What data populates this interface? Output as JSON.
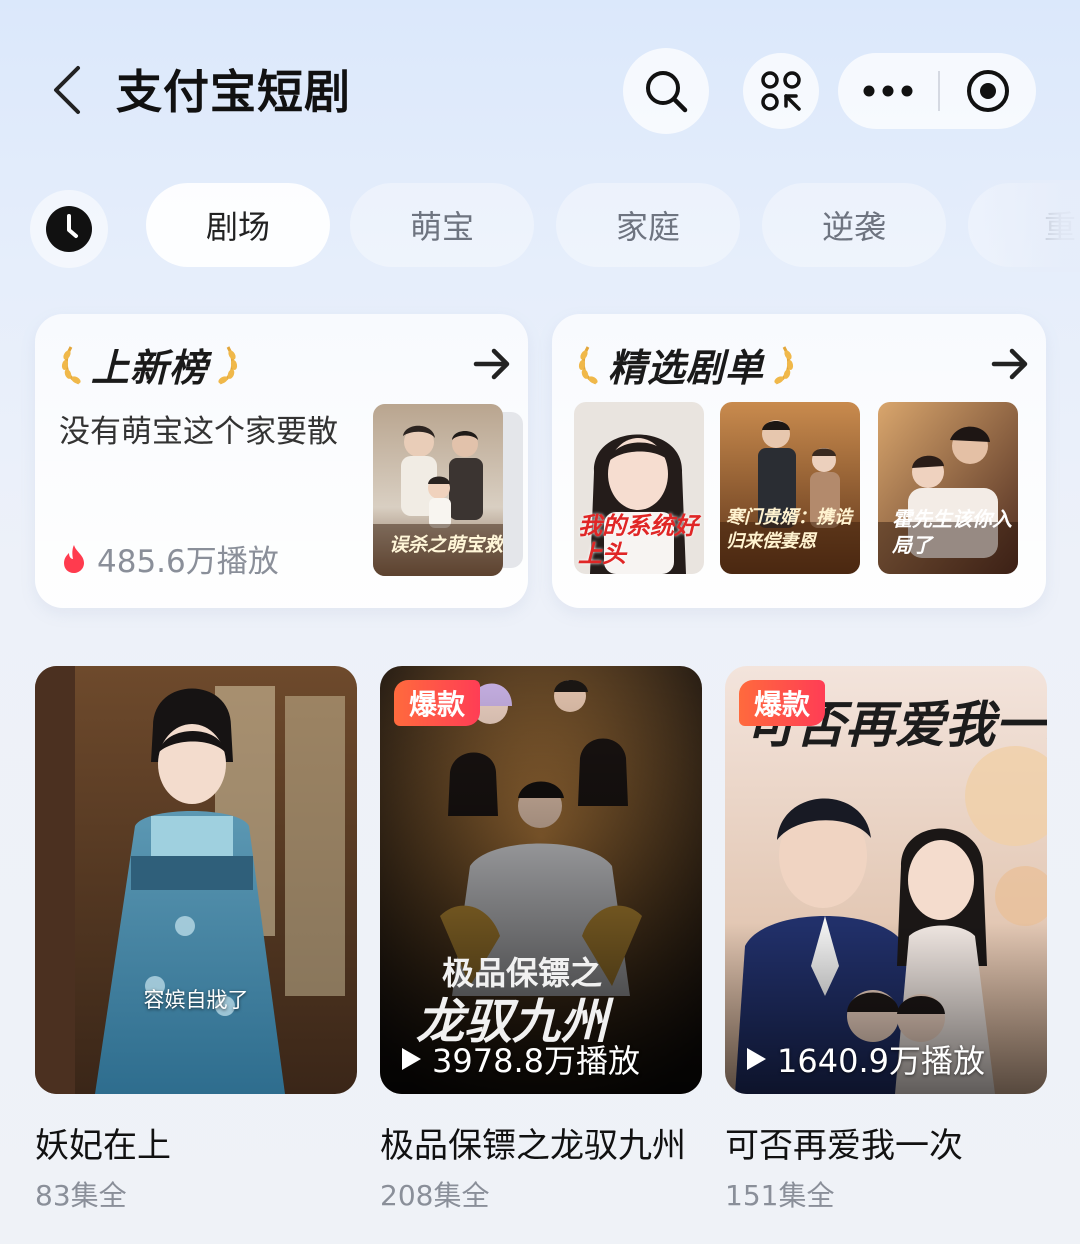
{
  "header": {
    "title": "支付宝短剧",
    "back_icon": "chevron-left-icon",
    "search_icon": "search-icon",
    "grid_icon": "mini-program-grid-icon",
    "more_icon": "more-dots-icon",
    "record_icon": "target-icon"
  },
  "tabs": {
    "history_icon": "clock-icon",
    "items": [
      {
        "label": "剧场",
        "active": true
      },
      {
        "label": "萌宝",
        "active": false
      },
      {
        "label": "家庭",
        "active": false
      },
      {
        "label": "逆袭",
        "active": false
      },
      {
        "label": "重",
        "active": false
      }
    ]
  },
  "new_list": {
    "title": "上新榜",
    "show_title": "没有萌宝这个家要散",
    "plays": "485.6万播放",
    "poster_text": "误杀之萌宝救星"
  },
  "picks": {
    "title": "精选剧单",
    "posters": [
      {
        "text": "我的系统好上头"
      },
      {
        "text": "寒门贵婿：携诰归来偿妻恩"
      },
      {
        "text": "霍先生该你入局了"
      }
    ]
  },
  "dramas": [
    {
      "name": "妖妃在上",
      "episodes": "83集全",
      "caption": "容嫔自戕了",
      "badge": "",
      "plays": ""
    },
    {
      "name": "极品保镖之龙驭九州",
      "episodes": "208集全",
      "caption": "",
      "badge": "爆款",
      "plays": "3978.8万播放",
      "poster_text": "极品保镖之",
      "poster_text2": "龙驭九州"
    },
    {
      "name": "可否再爱我一次",
      "episodes": "151集全",
      "caption": "",
      "badge": "爆款",
      "plays": "1640.9万播放",
      "poster_text": "可否再爱我一次"
    }
  ],
  "colors": {
    "hot_badge": "#ff4d4a",
    "fire": "#ff3b4e",
    "laurel": "#f0b84a"
  }
}
